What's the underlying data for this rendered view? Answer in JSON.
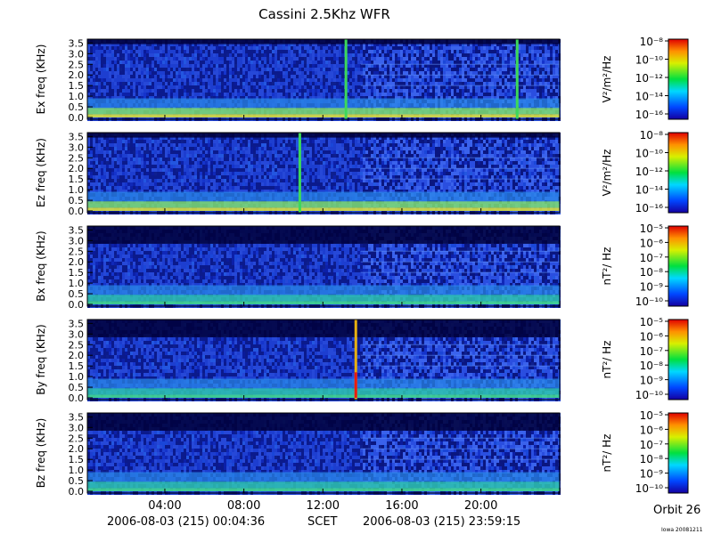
{
  "title": "Cassini 2.5Khz WFR",
  "colors": {
    "background": "#000044",
    "dark": "#0b1a8c",
    "mid": "#1e3ccf",
    "cyan": "#27c8e0",
    "green": "#3dd85a",
    "yellow": "#f2e21a",
    "red": "#e81a10"
  },
  "x_ticks": [
    "04:00",
    "08:00",
    "12:00",
    "16:00",
    "20:00"
  ],
  "footer": {
    "start": "2006-08-03 (215) 00:04:36",
    "axis_label": "SCET",
    "end": "2006-08-03 (215) 23:59:15",
    "orbit": "Orbit 26",
    "credit": "Iowa 20081211"
  },
  "chart_data": [
    {
      "type": "heatmap",
      "panel": "Ex",
      "ylabel": "Ex freq (KHz)",
      "y_ticks": [
        "0.0",
        "0.5",
        "1.0",
        "1.5",
        "2.0",
        "2.5",
        "3.0",
        "3.5"
      ],
      "ylim": [
        0,
        3.6
      ],
      "xlim": [
        "00:04:36",
        "23:59:15"
      ],
      "colorbar_label": "V²/m²/Hz",
      "colorbar_ticks": [
        "10⁻⁸",
        "10⁻¹⁰",
        "10⁻¹²",
        "10⁻¹⁴",
        "10⁻¹⁶"
      ],
      "spikes": [
        {
          "time": "13:10",
          "color": "green"
        },
        {
          "time": "21:50",
          "color": "green"
        }
      ]
    },
    {
      "type": "heatmap",
      "panel": "Ez",
      "ylabel": "Ez freq (KHz)",
      "y_ticks": [
        "0.0",
        "0.5",
        "1.0",
        "1.5",
        "2.0",
        "2.5",
        "3.0",
        "3.5"
      ],
      "ylim": [
        0,
        3.6
      ],
      "xlim": [
        "00:04:36",
        "23:59:15"
      ],
      "colorbar_label": "V²/m²/Hz",
      "colorbar_ticks": [
        "10⁻⁸",
        "10⁻¹⁰",
        "10⁻¹²",
        "10⁻¹⁴",
        "10⁻¹⁶"
      ],
      "spikes": [
        {
          "time": "10:50",
          "color": "green"
        }
      ]
    },
    {
      "type": "heatmap",
      "panel": "Bx",
      "ylabel": "Bx freq (KHz)",
      "y_ticks": [
        "0.0",
        "0.5",
        "1.0",
        "1.5",
        "2.0",
        "2.5",
        "3.0",
        "3.5"
      ],
      "ylim": [
        0,
        3.6
      ],
      "xlim": [
        "00:04:36",
        "23:59:15"
      ],
      "colorbar_label": "nT²/ Hz",
      "colorbar_ticks": [
        "10⁻⁵",
        "10⁻⁶",
        "10⁻⁷",
        "10⁻⁸",
        "10⁻⁹",
        "10⁻¹⁰"
      ],
      "spikes": []
    },
    {
      "type": "heatmap",
      "panel": "By",
      "ylabel": "By freq (KHz)",
      "y_ticks": [
        "0.0",
        "0.5",
        "1.0",
        "1.5",
        "2.0",
        "2.5",
        "3.0",
        "3.5"
      ],
      "ylim": [
        0,
        3.6
      ],
      "xlim": [
        "00:04:36",
        "23:59:15"
      ],
      "colorbar_label": "nT²/ Hz",
      "colorbar_ticks": [
        "10⁻⁵",
        "10⁻⁶",
        "10⁻⁷",
        "10⁻⁸",
        "10⁻⁹",
        "10⁻¹⁰"
      ],
      "spikes": [
        {
          "time": "13:40",
          "color": "red"
        }
      ]
    },
    {
      "type": "heatmap",
      "panel": "Bz",
      "ylabel": "Bz freq (KHz)",
      "y_ticks": [
        "0.0",
        "0.5",
        "1.0",
        "1.5",
        "2.0",
        "2.5",
        "3.0",
        "3.5"
      ],
      "ylim": [
        0,
        3.6
      ],
      "xlim": [
        "00:04:36",
        "23:59:15"
      ],
      "colorbar_label": "nT²/ Hz",
      "colorbar_ticks": [
        "10⁻⁵",
        "10⁻⁶",
        "10⁻⁷",
        "10⁻⁸",
        "10⁻⁹",
        "10⁻¹⁰"
      ],
      "spikes": []
    }
  ]
}
